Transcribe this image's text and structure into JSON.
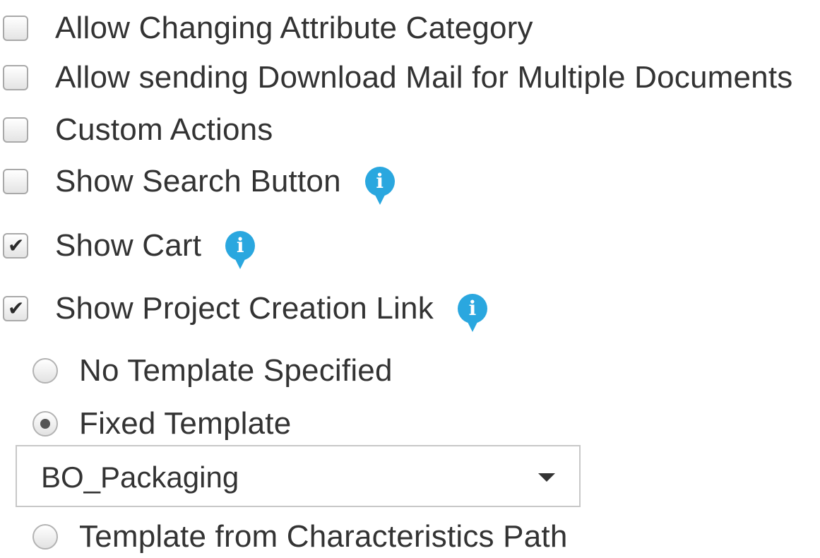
{
  "options": [
    {
      "label": "Allow Changing Attribute Category",
      "checked": false,
      "has_info": false
    },
    {
      "label": "Allow sending Download Mail for Multiple Documents",
      "checked": false,
      "has_info": false
    },
    {
      "label": "Custom Actions",
      "checked": false,
      "has_info": false
    },
    {
      "label": "Show Search Button",
      "checked": false,
      "has_info": true
    },
    {
      "label": "Show Cart",
      "checked": true,
      "has_info": true
    },
    {
      "label": "Show Project Creation Link",
      "checked": true,
      "has_info": true
    }
  ],
  "template_options": [
    {
      "label": "No Template Specified",
      "selected": false
    },
    {
      "label": "Fixed Template",
      "selected": true
    },
    {
      "label": "Template from Characteristics Path",
      "selected": false
    }
  ],
  "template_select": {
    "value": "BO_Packaging"
  },
  "icons": {
    "info": "info-icon",
    "check": "checkmark-icon",
    "dropdown": "chevron-down-icon",
    "info_glyph": "i",
    "check_glyph": "✔"
  },
  "colors": {
    "info": "#2aa7df",
    "text": "#333333"
  }
}
